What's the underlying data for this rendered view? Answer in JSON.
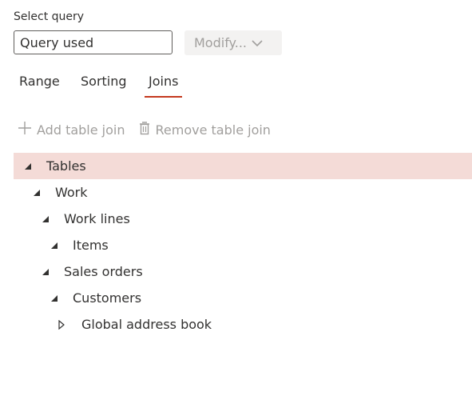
{
  "query_selector": {
    "label": "Select query",
    "value": "Query used",
    "modify_label": "Modify..."
  },
  "tabs": [
    {
      "label": "Range",
      "active": false
    },
    {
      "label": "Sorting",
      "active": false
    },
    {
      "label": "Joins",
      "active": true
    }
  ],
  "toolbar": {
    "add_label": "Add table join",
    "add_icon": "plus-icon",
    "remove_label": "Remove table join",
    "remove_icon": "trash-icon"
  },
  "tree": [
    {
      "label": "Tables",
      "expanded": true,
      "selected": true
    },
    {
      "label": "Work",
      "expanded": true,
      "selected": false
    },
    {
      "label": "Work lines",
      "expanded": true,
      "selected": false
    },
    {
      "label": "Items",
      "expanded": true,
      "selected": false
    },
    {
      "label": "Sales orders",
      "expanded": true,
      "selected": false
    },
    {
      "label": "Customers",
      "expanded": true,
      "selected": false
    },
    {
      "label": "Global address book",
      "expanded": false,
      "selected": false
    }
  ],
  "colors": {
    "accent": "#c4391e",
    "selected_row": "#f4dbd7",
    "disabled_text": "#a19f9d",
    "text": "#323130"
  }
}
